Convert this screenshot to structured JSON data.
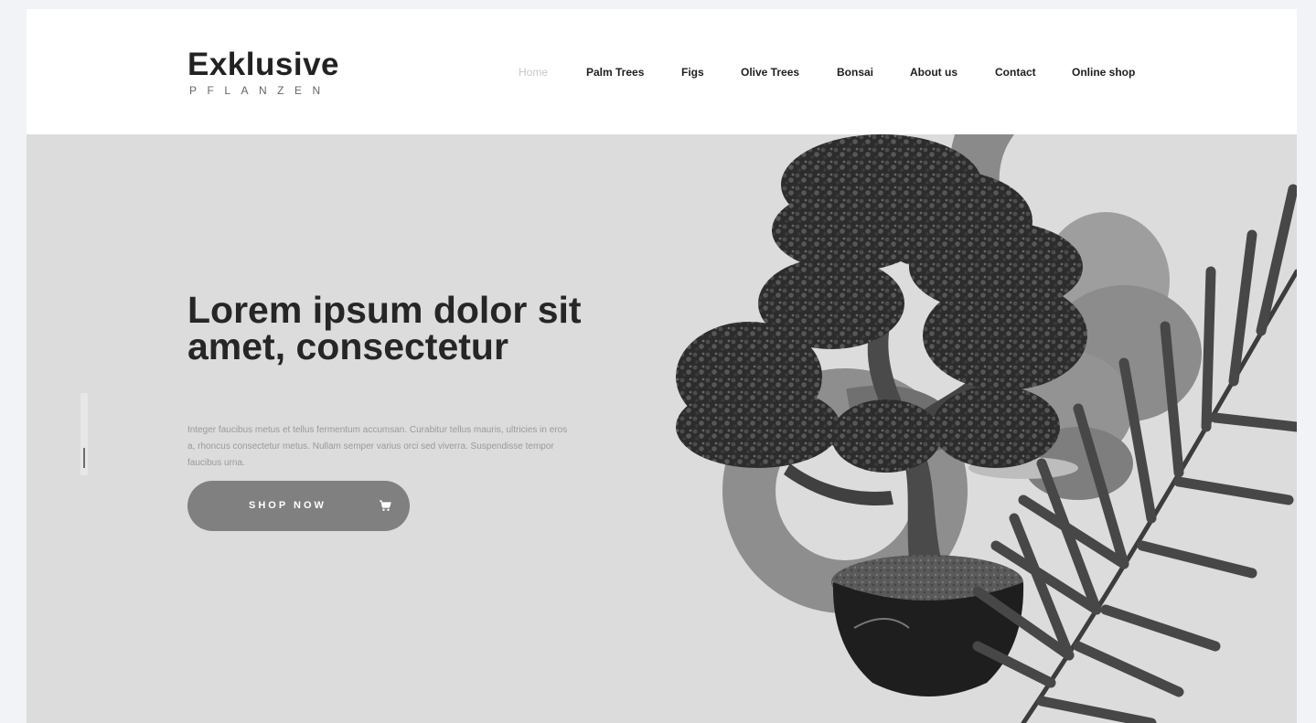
{
  "brand": {
    "name": "Exklusive",
    "tagline": "PFLANZEN"
  },
  "nav": {
    "items": [
      {
        "label": "Home",
        "active": true
      },
      {
        "label": "Palm Trees",
        "active": false
      },
      {
        "label": "Figs",
        "active": false
      },
      {
        "label": "Olive Trees",
        "active": false
      },
      {
        "label": "Bonsai",
        "active": false
      },
      {
        "label": "About us",
        "active": false
      },
      {
        "label": "Contact",
        "active": false
      },
      {
        "label": "Online shop",
        "active": false
      }
    ]
  },
  "hero": {
    "title": "Lorem ipsum dolor sit amet, consectetur",
    "text": "Integer faucibus metus et tellus fermentum accumsan. Curabitur tellus mauris, ultricies in eros a, rhoncus consectetur metus. Nullam semper varius orci sed viverra. Suspendisse tempor faucibus urna.",
    "button_label": "SHOP NOW",
    "button_icon": "cart-icon"
  },
  "colors": {
    "page_background": "#f2f3f6",
    "header_background": "#ffffff",
    "hero_background": "#dcdcdc",
    "button_background": "#808080",
    "text_dark": "#262626",
    "text_muted": "#9a9a9a",
    "nav_active": "#c8c8c8"
  }
}
